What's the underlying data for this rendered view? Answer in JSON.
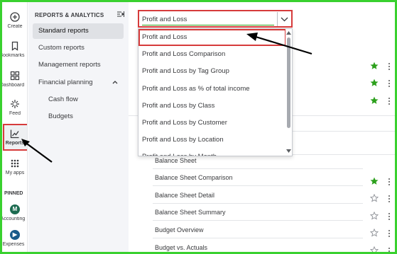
{
  "rail": {
    "items": [
      {
        "key": "create",
        "label": "Create",
        "icon": "plus-circle-icon"
      },
      {
        "key": "bookmarks",
        "label": "Bookmarks",
        "icon": "bookmark-icon"
      },
      {
        "key": "dashboard",
        "label": "Dashboard",
        "icon": "dashboard-grid-icon"
      },
      {
        "key": "feed",
        "label": "Feed",
        "icon": "sparkle-icon"
      },
      {
        "key": "reports",
        "label": "Reports",
        "icon": "line-chart-icon"
      },
      {
        "key": "myapps",
        "label": "My apps",
        "icon": "apps-grid-icon"
      }
    ],
    "pinned_label": "PINNED",
    "pinned": [
      {
        "label": "Accounting",
        "icon": "accounting-app-icon"
      },
      {
        "label": "Expenses",
        "icon": "expenses-app-icon"
      }
    ]
  },
  "subnav": {
    "header": "REPORTS & ANALYTICS",
    "items": [
      {
        "label": "Standard reports",
        "active": true
      },
      {
        "label": "Custom reports"
      },
      {
        "label": "Management reports"
      },
      {
        "label": "Financial planning",
        "expanded": true
      },
      {
        "label": "Cash flow",
        "child": true
      },
      {
        "label": "Budgets",
        "child": true
      }
    ]
  },
  "search": {
    "value": "Profit and Loss",
    "dropdown_options": [
      "Profit and Loss",
      "Profit and Loss Comparison",
      "Profit and Loss by Tag Group",
      "Profit and Loss as % of total income",
      "Profit and Loss by Class",
      "Profit and Loss by Customer",
      "Profit and Loss by Location",
      "Profit and Loss by Month"
    ],
    "highlighted_index": 0
  },
  "reports": {
    "rows": [
      {
        "label": "Balance Sheet",
        "favorite": true
      },
      {
        "label": "Balance Sheet Comparison",
        "favorite": false
      },
      {
        "label": "Balance Sheet Detail",
        "favorite": false
      },
      {
        "label": "Balance Sheet Summary",
        "favorite": false
      },
      {
        "label": "Budget Overview",
        "favorite": false
      },
      {
        "label": "Budget vs. Actuals",
        "favorite": false
      }
    ]
  },
  "colors": {
    "frame": "#39d12f",
    "highlight_box": "#d63b3b",
    "star_filled": "#2ca01c",
    "star_empty": "#8d9096"
  }
}
